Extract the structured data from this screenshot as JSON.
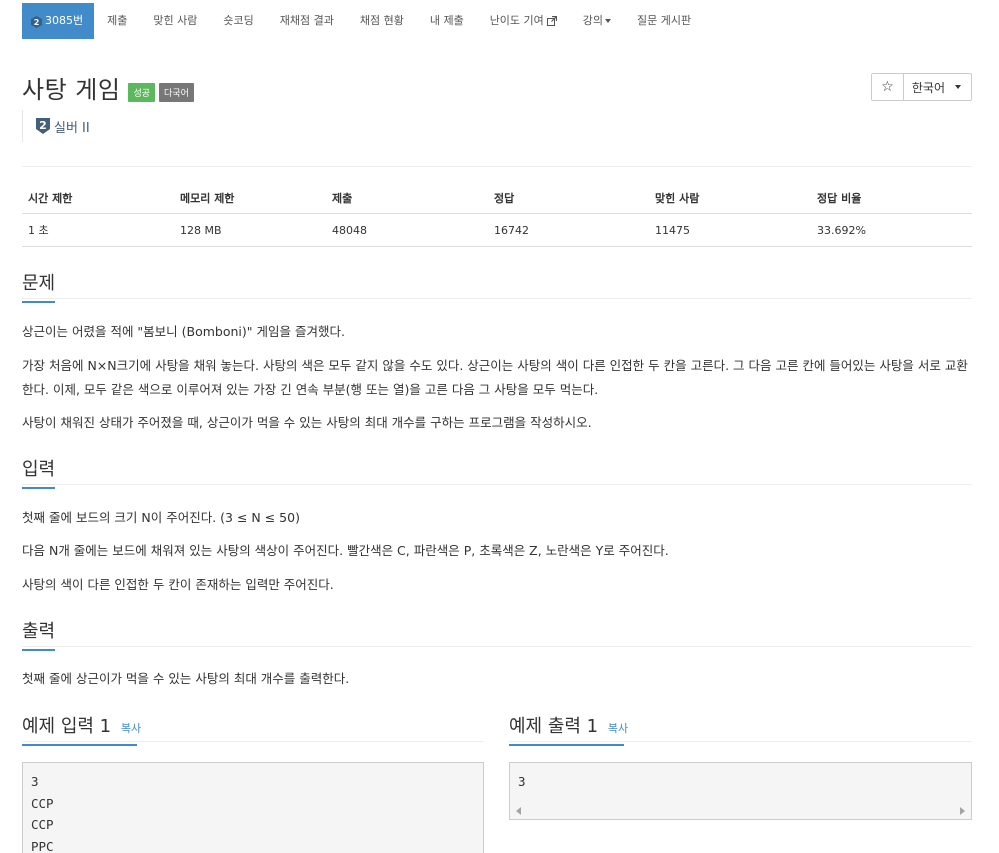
{
  "nav": {
    "active_tab": "3085번",
    "items": [
      "제출",
      "맞힌 사람",
      "숏코딩",
      "재채점 결과",
      "채점 현황",
      "내 제출",
      "난이도 기여",
      "강의",
      "질문 게시판"
    ]
  },
  "problem": {
    "title": "사탕 게임",
    "labels": [
      "성공",
      "다국어"
    ],
    "tier": "실버 II",
    "tier_number": "2"
  },
  "toolbar": {
    "star": "☆",
    "language": "한국어"
  },
  "info_table": {
    "headers": [
      "시간 제한",
      "메모리 제한",
      "제출",
      "정답",
      "맞힌 사람",
      "정답 비율"
    ],
    "values": [
      "1 초",
      "128 MB",
      "48048",
      "16742",
      "11475",
      "33.692%"
    ]
  },
  "sections": {
    "problem_heading": "문제",
    "problem_paragraphs": [
      "상근이는 어렸을 적에 \"봄보니 (Bomboni)\" 게임을 즐겨했다.",
      "가장 처음에 N×N크기에 사탕을 채워 놓는다. 사탕의 색은 모두 같지 않을 수도 있다. 상근이는 사탕의 색이 다른 인접한 두 칸을 고른다. 그 다음 고른 칸에 들어있는 사탕을 서로 교환한다. 이제, 모두 같은 색으로 이루어져 있는 가장 긴 연속 부분(행 또는 열)을 고른 다음 그 사탕을 모두 먹는다.",
      "사탕이 채워진 상태가 주어졌을 때, 상근이가 먹을 수 있는 사탕의 최대 개수를 구하는 프로그램을 작성하시오."
    ],
    "input_heading": "입력",
    "input_paragraphs": [
      "첫째 줄에 보드의 크기 N이 주어진다. (3 ≤ N ≤ 50)",
      "다음 N개 줄에는 보드에 채워져 있는 사탕의 색상이 주어진다. 빨간색은 C, 파란색은 P, 초록색은 Z, 노란색은 Y로 주어진다.",
      "사탕의 색이 다른 인접한 두 칸이 존재하는 입력만 주어진다."
    ],
    "output_heading": "출력",
    "output_paragraphs": [
      "첫째 줄에 상근이가 먹을 수 있는 사탕의 최대 개수를 출력한다."
    ]
  },
  "samples": {
    "input_heading": "예제 입력 1",
    "output_heading": "예제 출력 1",
    "copy_label": "복사",
    "input_lines": [
      "3",
      "CCP",
      "CCP",
      "PPC"
    ],
    "output_lines": [
      "3"
    ]
  },
  "colors": {
    "accent": "#428bca",
    "success": "#5cb85c",
    "default_label": "#777777",
    "tier_text": "#435f7a"
  }
}
